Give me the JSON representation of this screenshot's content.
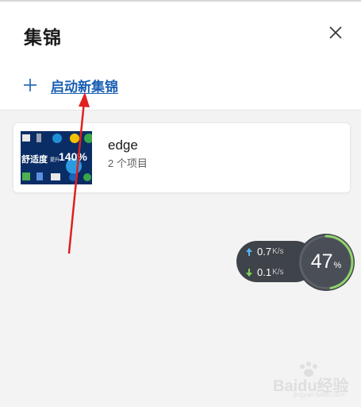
{
  "header": {
    "title": "集锦"
  },
  "actions": {
    "new_collection_label": "启动新集锦"
  },
  "collections": [
    {
      "name": "edge",
      "count_label": "2 个项目",
      "thumb_text": "舒适度",
      "thumb_sub": "提升",
      "thumb_number": "140%"
    }
  ],
  "net_monitor": {
    "upload": {
      "value": "0.7",
      "unit": "K/s"
    },
    "download": {
      "value": "0.1",
      "unit": "K/s"
    },
    "percent": {
      "value": "47",
      "sign": "%",
      "fraction": 0.47
    }
  },
  "watermark": {
    "text": "Baidu经验",
    "sub": "jingyan.baidu.com"
  },
  "colors": {
    "link": "#1a5fb4",
    "annotation_arrow": "#e02020",
    "gauge_arc": "#8fd46b"
  }
}
